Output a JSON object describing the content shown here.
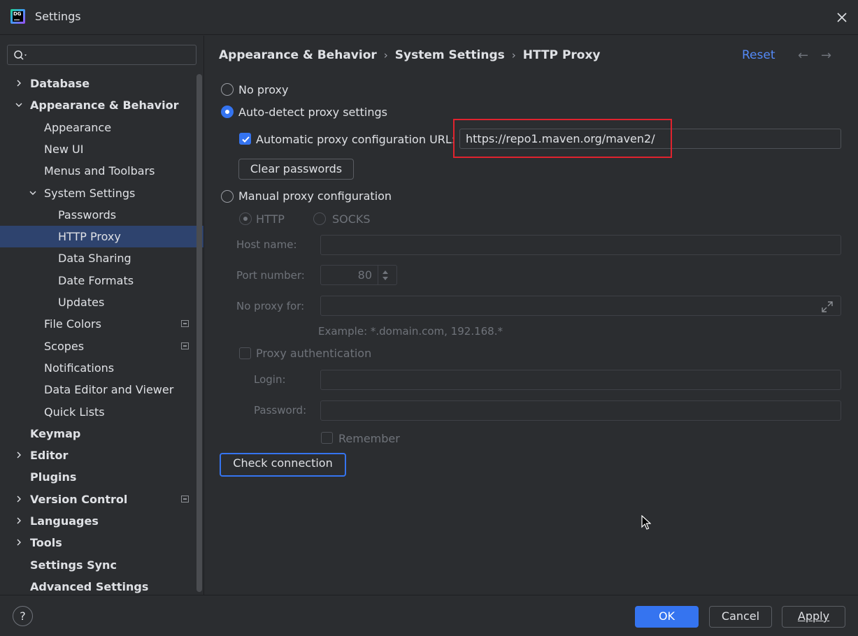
{
  "window": {
    "title": "Settings",
    "logo_text": "DG"
  },
  "search": {
    "placeholder": "",
    "value": ""
  },
  "sidebar": {
    "items": [
      {
        "label": "Database",
        "level": 0,
        "chevron": "right"
      },
      {
        "label": "Appearance & Behavior",
        "level": 0,
        "chevron": "down"
      },
      {
        "label": "Appearance",
        "level": 1
      },
      {
        "label": "New UI",
        "level": 1
      },
      {
        "label": "Menus and Toolbars",
        "level": 1
      },
      {
        "label": "System Settings",
        "level": 1,
        "chevron": "down"
      },
      {
        "label": "Passwords",
        "level": 2
      },
      {
        "label": "HTTP Proxy",
        "level": 2,
        "selected": true
      },
      {
        "label": "Data Sharing",
        "level": 2
      },
      {
        "label": "Date Formats",
        "level": 2
      },
      {
        "label": "Updates",
        "level": 2
      },
      {
        "label": "File Colors",
        "level": 1,
        "project_icon": true
      },
      {
        "label": "Scopes",
        "level": 1,
        "project_icon": true
      },
      {
        "label": "Notifications",
        "level": 1
      },
      {
        "label": "Data Editor and Viewer",
        "level": 1
      },
      {
        "label": "Quick Lists",
        "level": 1
      },
      {
        "label": "Keymap",
        "level": 0
      },
      {
        "label": "Editor",
        "level": 0,
        "chevron": "right"
      },
      {
        "label": "Plugins",
        "level": 0
      },
      {
        "label": "Version Control",
        "level": 0,
        "chevron": "right",
        "project_icon": true
      },
      {
        "label": "Languages",
        "level": 0,
        "chevron": "right"
      },
      {
        "label": "Tools",
        "level": 0,
        "chevron": "right"
      },
      {
        "label": "Settings Sync",
        "level": 0
      },
      {
        "label": "Advanced Settings",
        "level": 0
      }
    ]
  },
  "breadcrumb": {
    "part1": "Appearance & Behavior",
    "part2": "System Settings",
    "part3": "HTTP Proxy",
    "separator": "›"
  },
  "header": {
    "reset_label": "Reset",
    "back_arrow": "←",
    "forward_arrow": "→"
  },
  "proxy": {
    "no_proxy_label": "No proxy",
    "auto_detect_label": "Auto-detect proxy settings",
    "auto_config_url_label": "Automatic proxy configuration URL:",
    "auto_config_url_value": "https://repo1.maven.org/maven2/",
    "clear_passwords_label": "Clear passwords",
    "manual_label": "Manual proxy configuration",
    "http_label": "HTTP",
    "socks_label": "SOCKS",
    "host_name_label": "Host name:",
    "host_name_value": "",
    "port_number_label": "Port number:",
    "port_number_value": "80",
    "no_proxy_for_label": "No proxy for:",
    "no_proxy_for_value": "",
    "example_text": "Example: *.domain.com, 192.168.*",
    "proxy_auth_label": "Proxy authentication",
    "login_label": "Login:",
    "login_value": "",
    "password_label": "Password:",
    "password_value": "",
    "remember_label": "Remember",
    "check_connection_label": "Check connection",
    "selected_mode": "auto-detect",
    "auto_config_url_checked": true
  },
  "footer": {
    "help_label": "?",
    "ok_label": "OK",
    "cancel_label": "Cancel",
    "apply_label": "Apply"
  },
  "colors": {
    "accent": "#3574f0",
    "link": "#548af7",
    "selection": "#2e436e",
    "highlight": "#e0232e",
    "background": "#2b2d30"
  }
}
